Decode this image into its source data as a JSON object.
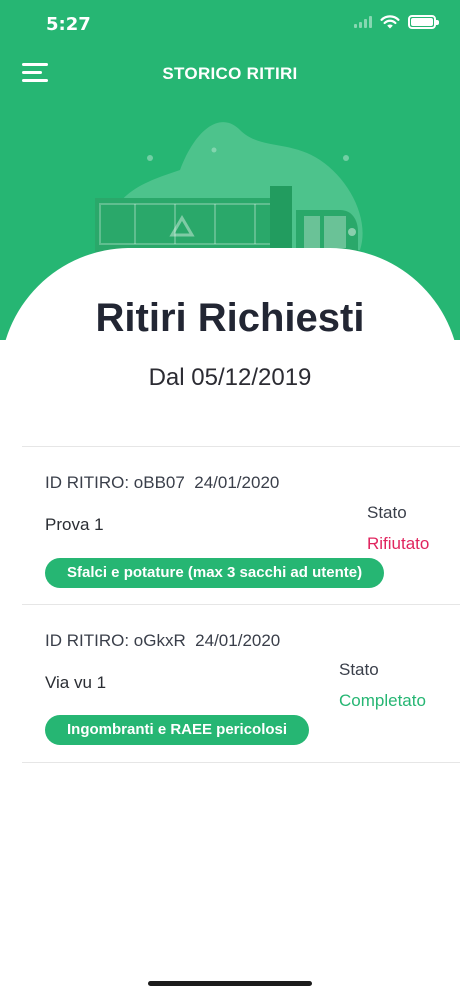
{
  "status_bar": {
    "time": "5:27"
  },
  "nav": {
    "title": "STORICO RITIRI"
  },
  "page": {
    "title": "Ritiri Richiesti",
    "subtitle": "Dal 05/12/2019"
  },
  "colors": {
    "brand_green": "#26b673",
    "state_rejected": "#e0245e",
    "state_completed": "#26b673"
  },
  "pickups": [
    {
      "id_line": "ID RITIRO: oBB07  24/01/2020",
      "address": "Prova 1",
      "state_label": "Stato",
      "state_value": "Rifiutato",
      "category": "Sfalci e potature (max 3 sacchi ad utente)"
    },
    {
      "id_line": "ID RITIRO: oGkxR  24/01/2020",
      "address": "Via vu 1",
      "state_label": "Stato",
      "state_value": "Completato",
      "category": "Ingombranti e RAEE pericolosi"
    }
  ]
}
